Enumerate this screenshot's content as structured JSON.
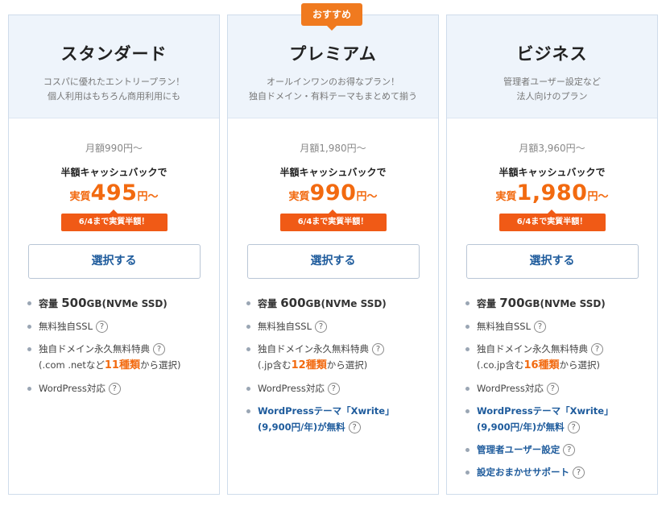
{
  "recommend_label": "おすすめ",
  "cashback_label": "半額キャッシュバックで",
  "jisshitsu_label": "実質",
  "unit_label": "円～",
  "badge_label": "6/4まで実質半額！",
  "select_label": "選択する",
  "help_glyph": "?",
  "plans": [
    {
      "name": "スタンダード",
      "desc1": "コスパに優れたエントリープラン！",
      "desc2": "個人利用はもちろん商用利用にも",
      "base_price": "月額990円～",
      "effective_price": "495",
      "features": {
        "storage_prefix": "容量",
        "storage_value": "500",
        "storage_suffix": "GB(NVMe SSD)",
        "ssl": "無料独自SSL",
        "domain_line1": "独自ドメイン永久無料特典",
        "domain_line2_a": "(.com .netなど",
        "domain_line2_hl": "11種類",
        "domain_line2_b": "から選択)",
        "wordpress": "WordPress対応"
      }
    },
    {
      "name": "プレミアム",
      "desc1": "オールインワンのお得なプラン！",
      "desc2": "独自ドメイン・有料テーマもまとめて揃う",
      "base_price": "月額1,980円～",
      "effective_price": "990",
      "features": {
        "storage_prefix": "容量",
        "storage_value": "600",
        "storage_suffix": "GB(NVMe SSD)",
        "ssl": "無料独自SSL",
        "domain_line1": "独自ドメイン永久無料特典",
        "domain_line2_a": "(.jp含む",
        "domain_line2_hl": "12種類",
        "domain_line2_b": "から選択)",
        "wordpress": "WordPress対応",
        "theme_line1": "WordPressテーマ「Xwrite」",
        "theme_line2": "(9,900円/年)が無料"
      }
    },
    {
      "name": "ビジネス",
      "desc1": "管理者ユーザー設定など",
      "desc2": "法人向けのプラン",
      "base_price": "月額3,960円～",
      "effective_price": "1,980",
      "features": {
        "storage_prefix": "容量",
        "storage_value": "700",
        "storage_suffix": "GB(NVMe SSD)",
        "ssl": "無料独自SSL",
        "domain_line1": "独自ドメイン永久無料特典",
        "domain_line2_a": "(.co.jp含む",
        "domain_line2_hl": "16種類",
        "domain_line2_b": "から選択)",
        "wordpress": "WordPress対応",
        "theme_line1": "WordPressテーマ「Xwrite」",
        "theme_line2": "(9,900円/年)が無料",
        "admin_user": "管理者ユーザー設定",
        "setup_support": "設定おまかせサポート"
      }
    }
  ]
}
